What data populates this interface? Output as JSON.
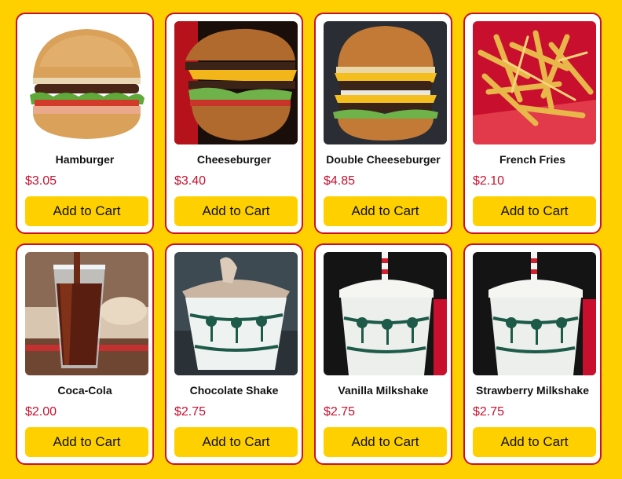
{
  "colors": {
    "background": "#FFD000",
    "border": "#C8102E",
    "price": "#C8102E",
    "button": "#FFD000"
  },
  "products": [
    {
      "name": "Hamburger",
      "price": "$3.05",
      "button": "Add to Cart",
      "image": "hamburger-photo"
    },
    {
      "name": "Cheeseburger",
      "price": "$3.40",
      "button": "Add to Cart",
      "image": "cheeseburger-photo"
    },
    {
      "name": "Double Cheeseburger",
      "price": "$4.85",
      "button": "Add to Cart",
      "image": "double-cheeseburger-photo"
    },
    {
      "name": "French Fries",
      "price": "$2.10",
      "button": "Add to Cart",
      "image": "french-fries-photo"
    },
    {
      "name": "Coca-Cola",
      "price": "$2.00",
      "button": "Add to Cart",
      "image": "coca-cola-photo"
    },
    {
      "name": "Chocolate Shake",
      "price": "$2.75",
      "button": "Add to Cart",
      "image": "chocolate-shake-photo"
    },
    {
      "name": "Vanilla Milkshake",
      "price": "$2.75",
      "button": "Add to Cart",
      "image": "vanilla-milkshake-photo"
    },
    {
      "name": "Strawberry Milkshake",
      "price": "$2.75",
      "button": "Add to Cart",
      "image": "strawberry-milkshake-photo"
    }
  ]
}
